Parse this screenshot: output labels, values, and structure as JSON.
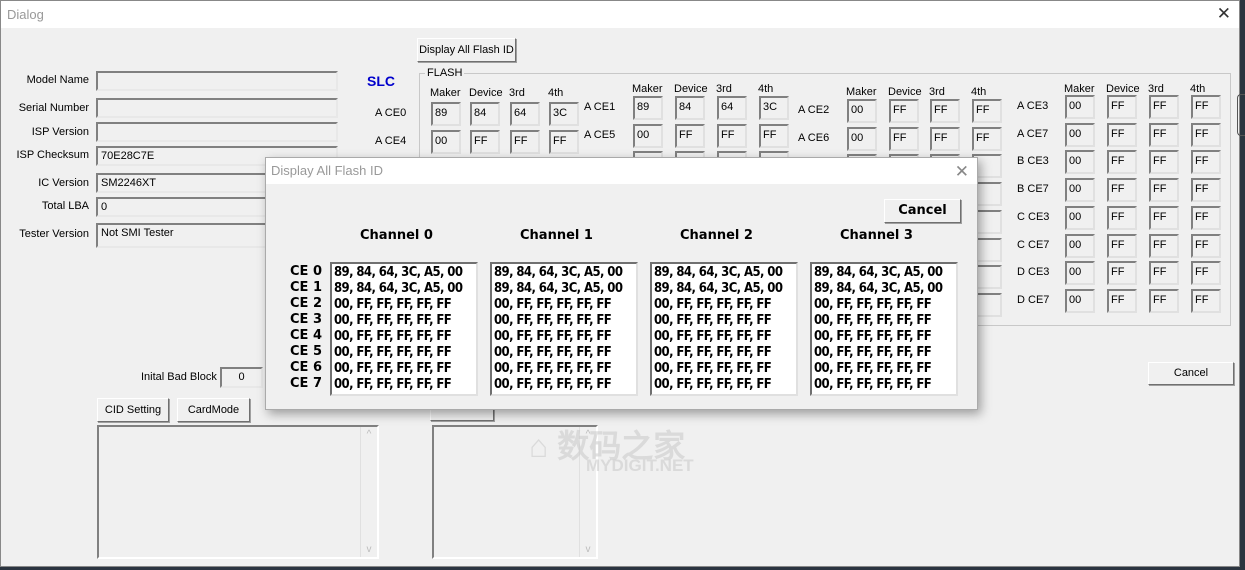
{
  "window": {
    "title": "Dialog"
  },
  "info": [
    {
      "label": "Model Name",
      "value": ""
    },
    {
      "label": "Serial Number",
      "value": ""
    },
    {
      "label": "ISP Version",
      "value": ""
    },
    {
      "label": "ISP Checksum",
      "value": "70E28C7E"
    },
    {
      "label": "IC Version",
      "value": "SM2246XT"
    },
    {
      "label": "Total LBA",
      "value": "0"
    },
    {
      "label": "Tester Version",
      "value": "Not SMI Tester"
    }
  ],
  "display_all_button": "Display All Flash ID",
  "cell_type": "SLC",
  "cell_type_color": "#0000cc",
  "flash": {
    "legend": "FLASH",
    "headers": [
      "Maker",
      "Device",
      "3rd",
      "4th"
    ],
    "groups": [
      {
        "rows": [
          {
            "label": "A CE0",
            "values": [
              "89",
              "84",
              "64",
              "3C"
            ]
          },
          {
            "label": "A CE4",
            "values": [
              "00",
              "FF",
              "FF",
              "FF"
            ]
          }
        ]
      },
      {
        "rows": [
          {
            "label": "A CE1",
            "values": [
              "89",
              "84",
              "64",
              "3C"
            ]
          },
          {
            "label": "A CE5",
            "values": [
              "00",
              "FF",
              "FF",
              "FF"
            ]
          }
        ]
      },
      {
        "rows": [
          {
            "label": "A CE2",
            "values": [
              "00",
              "FF",
              "FF",
              "FF"
            ]
          },
          {
            "label": "A CE6",
            "values": [
              "00",
              "FF",
              "FF",
              "FF"
            ]
          }
        ]
      },
      {
        "rows": [
          {
            "label": "A CE3",
            "values": [
              "00",
              "FF",
              "FF",
              "FF"
            ]
          },
          {
            "label": "A CE7",
            "values": [
              "00",
              "FF",
              "FF",
              "FF"
            ]
          },
          {
            "label": "B CE3",
            "values": [
              "00",
              "FF",
              "FF",
              "FF"
            ]
          },
          {
            "label": "B CE7",
            "values": [
              "00",
              "FF",
              "FF",
              "FF"
            ]
          },
          {
            "label": "C CE3",
            "values": [
              "00",
              "FF",
              "FF",
              "FF"
            ]
          },
          {
            "label": "C CE7",
            "values": [
              "00",
              "FF",
              "FF",
              "FF"
            ]
          },
          {
            "label": "D CE3",
            "values": [
              "00",
              "FF",
              "FF",
              "FF"
            ]
          },
          {
            "label": "D CE7",
            "values": [
              "00",
              "FF",
              "FF",
              "FF"
            ]
          }
        ]
      }
    ]
  },
  "initial_bad_block": {
    "label": "Inital Bad Block",
    "value": "0"
  },
  "buttons": {
    "cid_setting": "CID Setting",
    "card_mode": "CardMode",
    "cancel": "Cancel"
  },
  "watermark": {
    "cn": "数码之家",
    "en": "MYDIGIT.NET"
  },
  "modal": {
    "title": "Display All Flash ID",
    "cancel": "Cancel",
    "ce_labels": [
      "CE 0",
      "CE 1",
      "CE 2",
      "CE 3",
      "CE 4",
      "CE 5",
      "CE 6",
      "CE 7"
    ],
    "channels": [
      {
        "name": "Channel 0",
        "rows": [
          "89, 84, 64, 3C, A5, 00",
          "89, 84, 64, 3C, A5, 00",
          "00, FF, FF, FF, FF, FF",
          "00, FF, FF, FF, FF, FF",
          "00, FF, FF, FF, FF, FF",
          "00, FF, FF, FF, FF, FF",
          "00, FF, FF, FF, FF, FF",
          "00, FF, FF, FF, FF, FF"
        ]
      },
      {
        "name": "Channel 1",
        "rows": [
          "89, 84, 64, 3C, A5, 00",
          "89, 84, 64, 3C, A5, 00",
          "00, FF, FF, FF, FF, FF",
          "00, FF, FF, FF, FF, FF",
          "00, FF, FF, FF, FF, FF",
          "00, FF, FF, FF, FF, FF",
          "00, FF, FF, FF, FF, FF",
          "00, FF, FF, FF, FF, FF"
        ]
      },
      {
        "name": "Channel 2",
        "rows": [
          "89, 84, 64, 3C, A5, 00",
          "89, 84, 64, 3C, A5, 00",
          "00, FF, FF, FF, FF, FF",
          "00, FF, FF, FF, FF, FF",
          "00, FF, FF, FF, FF, FF",
          "00, FF, FF, FF, FF, FF",
          "00, FF, FF, FF, FF, FF",
          "00, FF, FF, FF, FF, FF"
        ]
      },
      {
        "name": "Channel 3",
        "rows": [
          "89, 84, 64, 3C, A5, 00",
          "89, 84, 64, 3C, A5, 00",
          "00, FF, FF, FF, FF, FF",
          "00, FF, FF, FF, FF, FF",
          "00, FF, FF, FF, FF, FF",
          "00, FF, FF, FF, FF, FF",
          "00, FF, FF, FF, FF, FF",
          "00, FF, FF, FF, FF, FF"
        ]
      }
    ]
  }
}
